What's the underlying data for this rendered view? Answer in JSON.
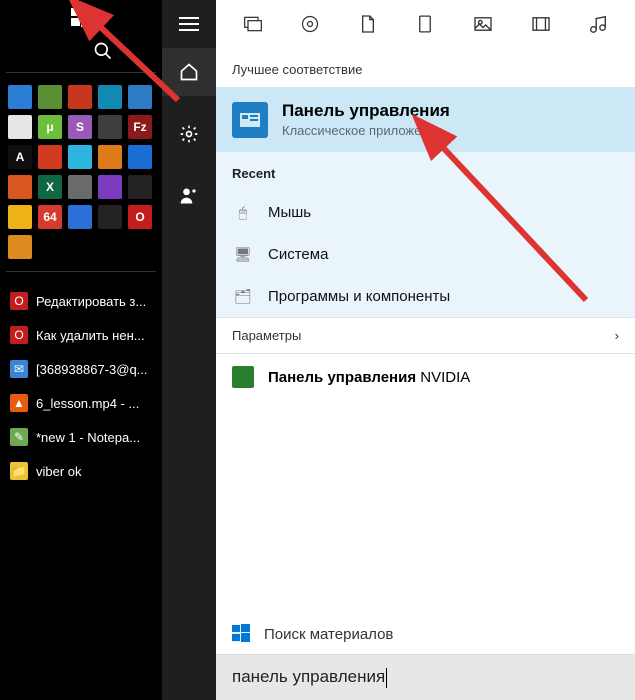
{
  "taskbar": {
    "items": [
      {
        "label": "Редактировать з...",
        "icon_color": "#c21e1e",
        "glyph": "O"
      },
      {
        "label": "Как удалить нен...",
        "icon_color": "#c21e1e",
        "glyph": "O"
      },
      {
        "label": "[368938867-3@q...",
        "icon_color": "#3a84d6",
        "glyph": "✉"
      },
      {
        "label": "6_lesson.mp4 - ...",
        "icon_color": "#e85c0d",
        "glyph": "▲"
      },
      {
        "label": "*new 1 - Notepa...",
        "icon_color": "#6ea850",
        "glyph": "✎"
      },
      {
        "label": "viber ok",
        "icon_color": "#e8c436",
        "glyph": "📁"
      }
    ]
  },
  "search": {
    "section_best": "Лучшее соответствие",
    "best_title": "Панель управления",
    "best_sub": "Классическое приложение",
    "section_recent": "Recent",
    "recent": [
      {
        "label": "Мышь",
        "glyph": "🖱"
      },
      {
        "label": "Система",
        "glyph": "🖥"
      },
      {
        "label": "Программы и компоненты",
        "glyph": "🗂"
      }
    ],
    "params_label": "Параметры",
    "more_bold": "Панель управления",
    "more_rest": " NVIDIA",
    "footer_label": "Поиск материалов",
    "input_value": "панель управления"
  },
  "tile_colors": [
    "#2b7cd3",
    "#5a8f33",
    "#c8361f",
    "#118ab2",
    "#2d7cc3",
    "#e6e6e6",
    "#6bbf3a",
    "#9b59b6",
    "#3e3e3e",
    "#8b1a1a",
    "#0f0f0f",
    "#d23b1f",
    "#2bb5e0",
    "#dd7b1a",
    "#1b6fd4",
    "#d8561f",
    "#116644",
    "#6a6a6a",
    "#7b3bbf",
    "#222",
    "#efb31a",
    "#d63c2d",
    "#2c6fd6",
    "#222",
    "#c21e1e",
    "#dd8a1f"
  ],
  "tile_glyphs": [
    "",
    "",
    "",
    "",
    "",
    "",
    "μ",
    "S",
    "",
    "Fz",
    "A",
    "",
    "",
    "",
    "",
    "",
    "X",
    "",
    "",
    "",
    "",
    "64",
    "",
    "",
    "O",
    ""
  ]
}
